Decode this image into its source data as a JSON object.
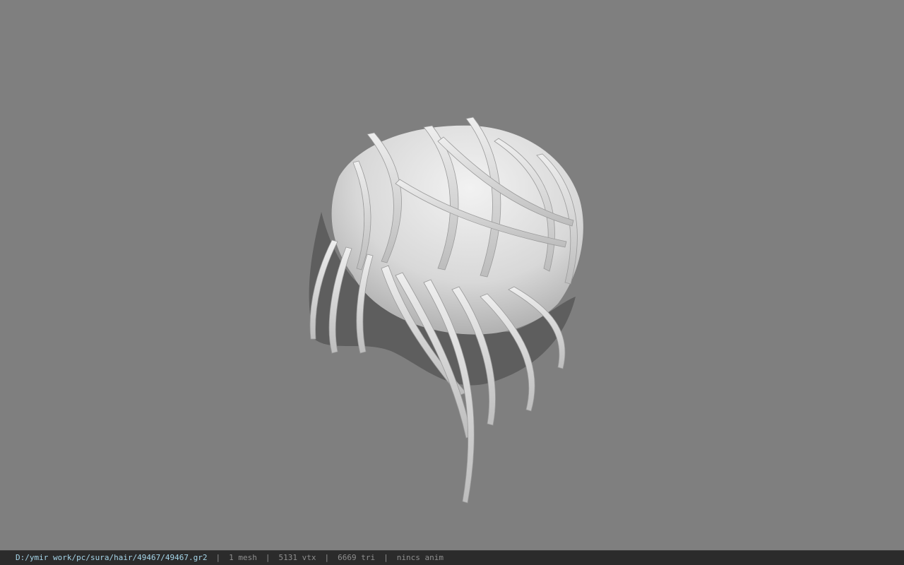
{
  "viewport": {
    "background_color": "#7f7f7f",
    "model": "hair mesh (gray shaded 3D render)"
  },
  "status_bar": {
    "path": "D:/ymir work/pc/sura/hair/49467/49467.gr2",
    "separator": "|",
    "mesh_count": "1 mesh",
    "vertex_count": "5131 vtx",
    "triangle_count": "6669 tri",
    "anim_status": "nincs anim"
  }
}
